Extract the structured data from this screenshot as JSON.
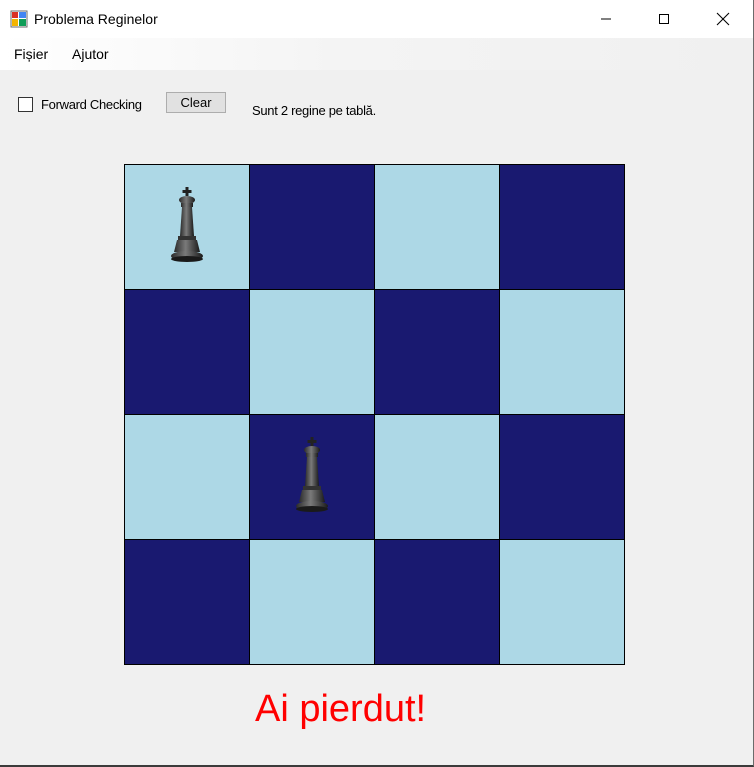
{
  "window": {
    "title": "Problema Reginelor"
  },
  "menu": {
    "items": [
      "Fișier",
      "Ajutor"
    ]
  },
  "controls": {
    "forward_checking_label": "Forward Checking",
    "forward_checking_checked": false,
    "clear_label": "Clear",
    "status": "Sunt 2 regine pe tablă."
  },
  "board": {
    "size": 4,
    "light_color": "#add8e6",
    "dark_color": "#191970",
    "queens": [
      {
        "row": 0,
        "col": 0
      },
      {
        "row": 2,
        "col": 1
      }
    ],
    "piece_icon": "queen-icon"
  },
  "result": {
    "text": "Ai pierdut!",
    "color": "#ff0000"
  }
}
